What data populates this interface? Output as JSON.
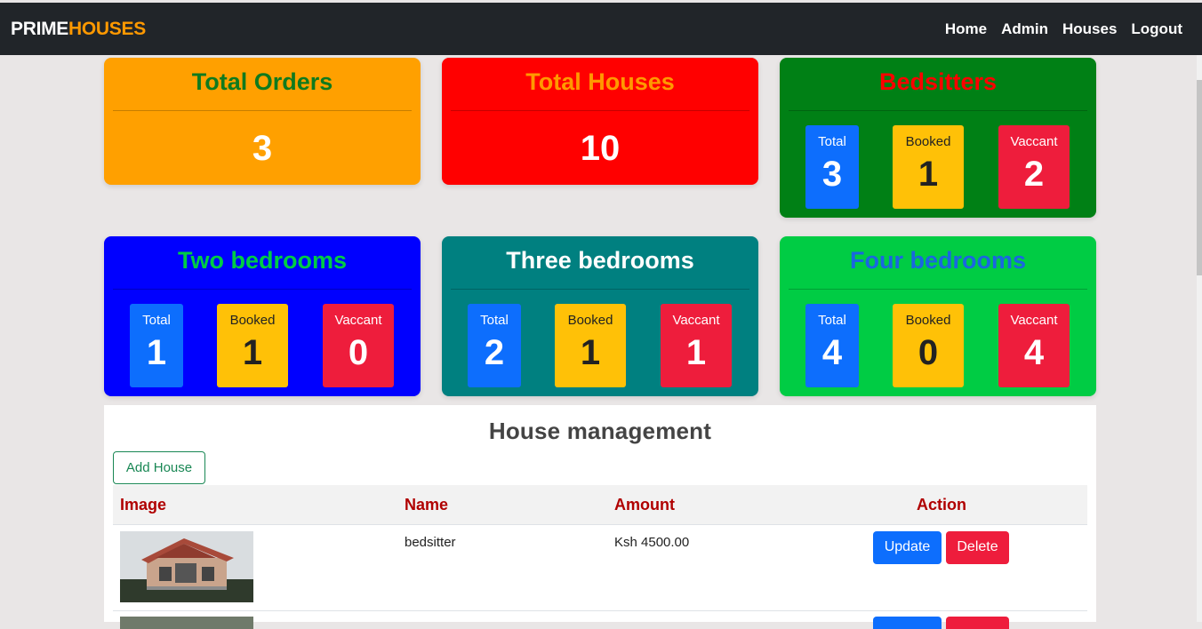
{
  "nav": {
    "brand_part1": "PRIME",
    "brand_part2": "HOUSES",
    "links": [
      "Home",
      "Admin",
      "Houses",
      "Logout"
    ]
  },
  "colors": {
    "navbar": "#212529",
    "brand_accent": "#ff9900",
    "orders_card": "#ffa000",
    "houses_card": "#ff0000",
    "bedsitters_card": "#008015",
    "two_bed_card": "#0000ff",
    "three_bed_card": "#008080",
    "four_bed_card": "#00cc44",
    "total_box": "#0d6efd",
    "booked_box": "#ffc107",
    "vacant_box": "#ee1d3c"
  },
  "summary": {
    "orders": {
      "title": "Total Orders",
      "value": "3"
    },
    "houses": {
      "title": "Total Houses",
      "value": "10"
    }
  },
  "stat_labels": {
    "total": "Total",
    "booked": "Booked",
    "vacant": "Vaccant"
  },
  "categories": {
    "bedsitters": {
      "title": "Bedsitters",
      "total": "3",
      "booked": "1",
      "vacant": "2"
    },
    "two_bedrooms": {
      "title": "Two bedrooms",
      "total": "1",
      "booked": "1",
      "vacant": "0"
    },
    "three_bedrooms": {
      "title": "Three bedrooms",
      "total": "2",
      "booked": "1",
      "vacant": "1"
    },
    "four_bedrooms": {
      "title": "Four bedrooms",
      "total": "4",
      "booked": "0",
      "vacant": "4"
    }
  },
  "management": {
    "title": "House management",
    "add_button": "Add House",
    "columns": [
      "Image",
      "Name",
      "Amount",
      "Action"
    ],
    "rows": [
      {
        "name": "bedsitter",
        "amount": "Ksh 4500.00",
        "update": "Update",
        "delete": "Delete"
      }
    ]
  }
}
